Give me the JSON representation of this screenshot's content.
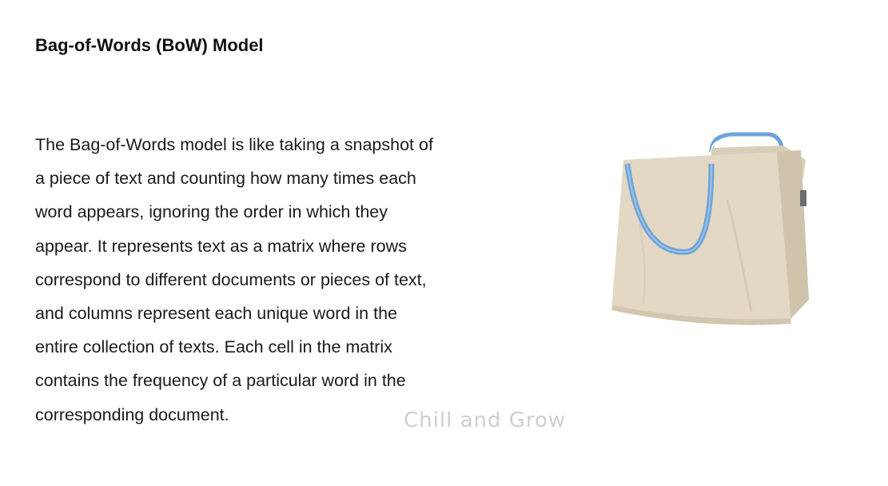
{
  "slide": {
    "title": "Bag-of-Words (BoW) Model",
    "body_lines": [
      "The Bag-of-Words model is like taking a snapshot of",
      "a piece of text and counting how many times each",
      "word appears, ignoring the order in which they",
      "appear. It represents text as a matrix where rows",
      "correspond to different documents or pieces of text,",
      "and columns represent each unique word in the",
      "entire collection of texts. Each cell in the matrix",
      "contains the frequency of a particular word in the",
      "corresponding document."
    ],
    "watermark": "Chill and Grow",
    "image_icon": "tote-bag-icon",
    "colors": {
      "bag_canvas": "#e3d8c4",
      "bag_handle": "#6fa3d8",
      "watermark": "#cfcfcf"
    }
  }
}
